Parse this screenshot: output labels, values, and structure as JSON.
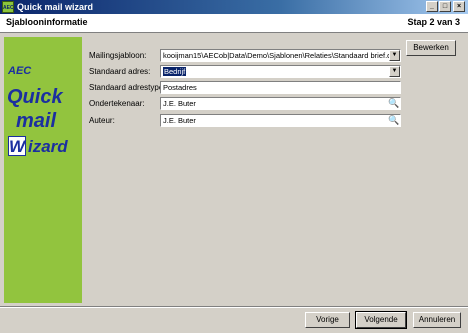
{
  "window": {
    "title": "Quick mail wizard",
    "icon_text": "AEC"
  },
  "header": {
    "title": "Sjablooninformatie",
    "step": "Stap 2 van 3"
  },
  "sidebar": {
    "logo_aec": "AEC",
    "logo_quick": "Quick",
    "logo_mail": "mail",
    "logo_w": "W",
    "logo_izard": "izard"
  },
  "form": {
    "template_label": "Mailingsjabloon:",
    "template_value": "kooijman15\\AECob|Data\\Demo\\Sjablonen\\Relaties\\Standaard brief.dc",
    "address_label": "Standaard adres:",
    "address_value": "Bedrijf",
    "address_type_label": "Standaard adrestype:",
    "address_type_value": "Postadres",
    "signer_label": "Ondertekenaar:",
    "signer_value": "J.E. Buter",
    "author_label": "Auteur:",
    "author_value": "J.E. Buter"
  },
  "buttons": {
    "edit": "Bewerken",
    "previous": "Vorige",
    "next": "Volgende",
    "cancel": "Annuleren"
  },
  "icons": {
    "lookup": "magnifier-icon",
    "dropdown": "chevron-down-icon"
  }
}
